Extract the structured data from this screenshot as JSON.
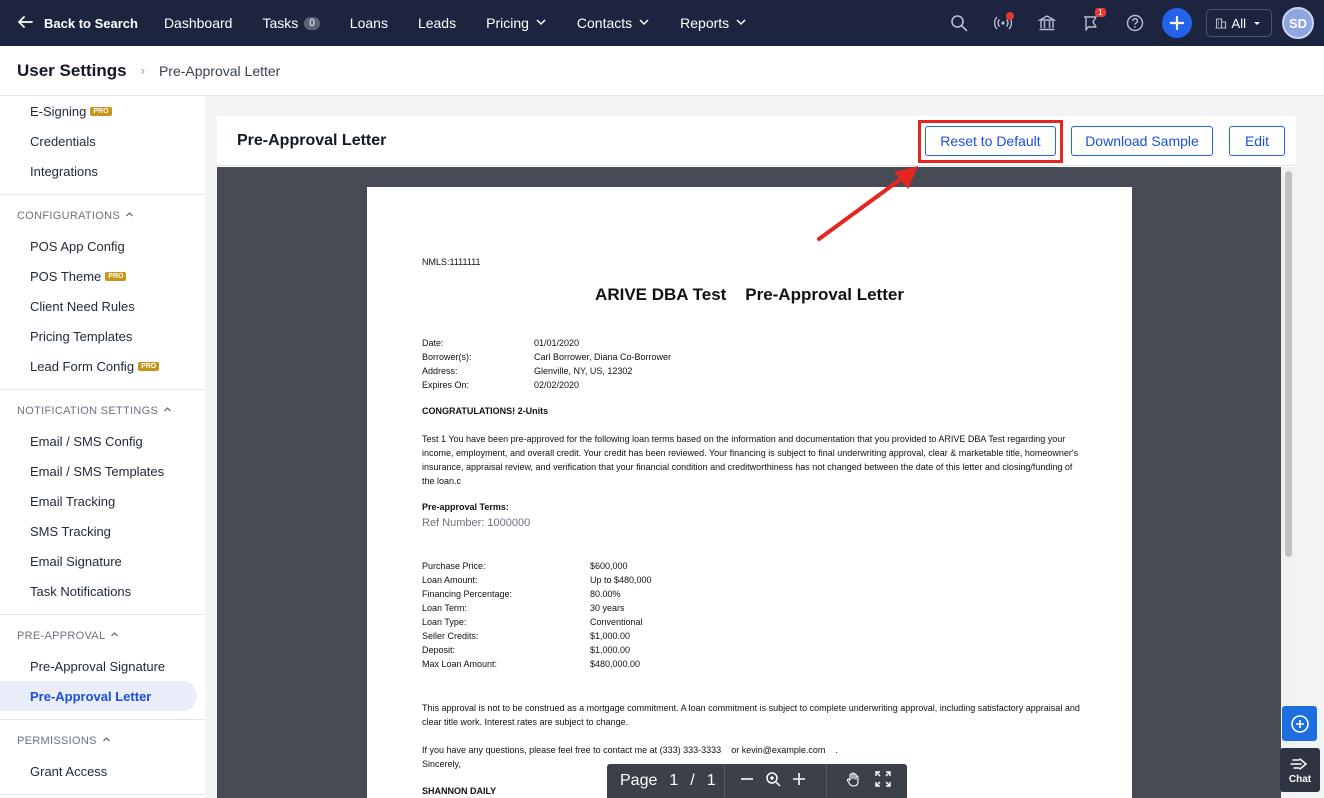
{
  "nav": {
    "back_label": "Back to Search",
    "items": [
      {
        "label": "Dashboard"
      },
      {
        "label": "Tasks",
        "badge": "0"
      },
      {
        "label": "Loans"
      },
      {
        "label": "Leads"
      },
      {
        "label": "Pricing",
        "dropdown": true
      },
      {
        "label": "Contacts",
        "dropdown": true
      },
      {
        "label": "Reports",
        "dropdown": true
      }
    ],
    "notification_count": "1",
    "scope_label": "All",
    "avatar_initials": "SD"
  },
  "breadcrumb": {
    "root": "User Settings",
    "current": "Pre-Approval Letter"
  },
  "sidebar": {
    "top_items": [
      {
        "label": "E-Signing",
        "pro": "PRO"
      },
      {
        "label": "Credentials"
      },
      {
        "label": "Integrations"
      }
    ],
    "sections": [
      {
        "title": "CONFIGURATIONS",
        "items": [
          {
            "label": "POS App Config"
          },
          {
            "label": "POS Theme",
            "pro": "PRO"
          },
          {
            "label": "Client Need Rules"
          },
          {
            "label": "Pricing Templates"
          },
          {
            "label": "Lead Form Config",
            "pro": "PRO"
          }
        ]
      },
      {
        "title": "NOTIFICATION SETTINGS",
        "items": [
          {
            "label": "Email / SMS Config"
          },
          {
            "label": "Email / SMS Templates"
          },
          {
            "label": "Email Tracking"
          },
          {
            "label": "SMS Tracking"
          },
          {
            "label": "Email Signature"
          },
          {
            "label": "Task Notifications"
          }
        ]
      },
      {
        "title": "PRE-APPROVAL",
        "items": [
          {
            "label": "Pre-Approval Signature"
          },
          {
            "label": "Pre-Approval Letter",
            "active": true
          }
        ]
      },
      {
        "title": "PERMISSIONS",
        "items": [
          {
            "label": "Grant Access"
          }
        ]
      }
    ]
  },
  "panel": {
    "title": "Pre-Approval Letter",
    "reset_label": "Reset to Default",
    "download_label": "Download Sample",
    "edit_label": "Edit"
  },
  "letter": {
    "nmls": "NMLS:1111111",
    "title": "ARIVE DBA Test    Pre-Approval Letter",
    "info": [
      {
        "k": "Date:",
        "v": "01/01/2020"
      },
      {
        "k": "Borrower(s):",
        "v": "Carl Borrower, Diana Co-Borrower"
      },
      {
        "k": "Address:",
        "v": "Glenville, NY, US, 12302"
      },
      {
        "k": "Expires On:",
        "v": "02/02/2020"
      }
    ],
    "congrats": "CONGRATULATIONS! 2-Units",
    "intro": "Test 1 You have been pre-approved for the following loan terms based on the information and  documentation that you provided to ARIVE DBA Test    regarding your income, employment, and overall credit. Your credit has  been reviewed. Your financing is subject to final underwriting approval, clear & marketable title, homeowner's  insurance, appraisal review, and verification that your financial condition and creditworthiness has not changed  between the date of this letter and closing/funding of the loan.c",
    "terms_heading": "Pre-approval Terms:",
    "ref_number": "Ref Number: 1000000",
    "terms": [
      {
        "k": "Purchase Price:",
        "v": "$600,000"
      },
      {
        "k": "Loan Amount:",
        "v": "Up to $480,000"
      },
      {
        "k": "Financing Percentage:",
        "v": "80.00%"
      },
      {
        "k": "Loan Term:",
        "v": "30 years"
      },
      {
        "k": "Loan Type:",
        "v": "Conventional"
      },
      {
        "k": "Seller Credits:",
        "v": "$1,000.00"
      },
      {
        "k": "Deposit:",
        "v": "$1,000.00"
      },
      {
        "k": "Max Loan Amount:",
        "v": "$480,000.00"
      }
    ],
    "disclaimer": "This approval is not to be construed as a mortgage commitment. A loan commitment is subject to  complete underwriting approval, including satisfactory appraisal and clear title work. Interest rates are subject  to change.",
    "contact": "If you have any questions, please feel free to contact me at (333) 333-3333    or kevin@example.com    .",
    "closing": "Sincerely,",
    "signer": "SHANNON DAILY"
  },
  "pdf_toolbar": {
    "page_label": "Page",
    "current_page": "1",
    "separator": "/",
    "total_pages": "1"
  },
  "chat_label": "Chat",
  "colors": {
    "nav_bg": "#1c2440",
    "accent": "#2563eb",
    "highlight": "#e52620",
    "viewer_bg": "#464b56"
  }
}
